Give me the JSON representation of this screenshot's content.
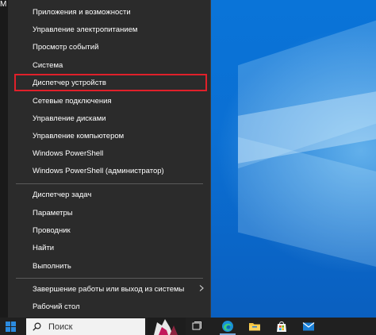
{
  "desktop": {
    "edge_text": "M"
  },
  "menu": {
    "groups": [
      {
        "items": [
          {
            "label": "Приложения и возможности"
          },
          {
            "label": "Управление электропитанием"
          },
          {
            "label": "Просмотр событий"
          },
          {
            "label": "Система"
          },
          {
            "label": "Диспетчер устройств",
            "highlighted": true
          },
          {
            "label": "Сетевые подключения"
          },
          {
            "label": "Управление дисками"
          },
          {
            "label": "Управление компьютером"
          },
          {
            "label": "Windows PowerShell"
          },
          {
            "label": "Windows PowerShell (администратор)"
          }
        ]
      },
      {
        "items": [
          {
            "label": "Диспетчер задач"
          },
          {
            "label": "Параметры"
          },
          {
            "label": "Проводник"
          },
          {
            "label": "Найти"
          },
          {
            "label": "Выполнить"
          }
        ]
      },
      {
        "items": [
          {
            "label": "Завершение работы или выход из системы",
            "submenu": true
          },
          {
            "label": "Рабочий стол"
          }
        ]
      }
    ],
    "highlight_color": "#e0202a"
  },
  "taskbar": {
    "search_placeholder": "Поиск",
    "icons": [
      "windows-start-icon",
      "search-icon",
      "task-view-icon",
      "edge-icon",
      "file-explorer-icon",
      "store-icon",
      "mail-icon"
    ]
  }
}
